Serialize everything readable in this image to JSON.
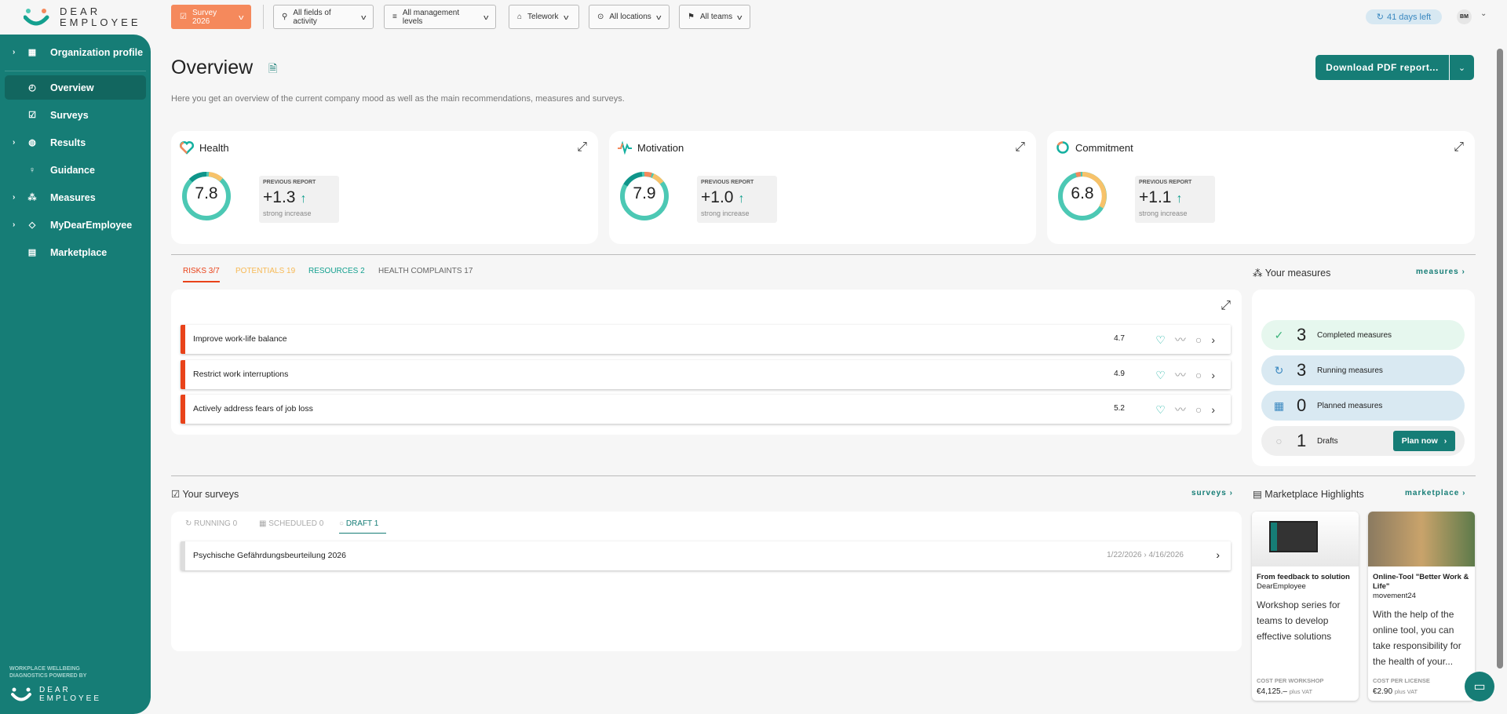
{
  "brand": {
    "line1": "DEAR",
    "line2": "EMPLOYEE",
    "powered": "WORKPLACE WELLBEING DIAGNOSTICS POWERED BY"
  },
  "filters": {
    "survey": "Survey 2026",
    "activity": "All fields of activity",
    "management": "All management levels",
    "telework": "Telework",
    "locations": "All locations",
    "teams": "All teams"
  },
  "header": {
    "days_left": "41 days left",
    "avatar": "BM"
  },
  "sidebar": {
    "items": [
      {
        "label": "Organization profile"
      },
      {
        "label": "Overview"
      },
      {
        "label": "Surveys"
      },
      {
        "label": "Results"
      },
      {
        "label": "Guidance"
      },
      {
        "label": "Measures"
      },
      {
        "label": "MyDearEmployee"
      },
      {
        "label": "Marketplace"
      }
    ]
  },
  "page": {
    "title": "Overview",
    "subtitle": "Here you get an overview of the current company mood as well as the main recommendations, measures and surveys.",
    "download": "Download PDF report..."
  },
  "kpis": [
    {
      "title": "Health",
      "score": "7.8",
      "prev_label": "PREVIOUS REPORT",
      "delta": "+1.3",
      "desc": "strong increase"
    },
    {
      "title": "Motivation",
      "score": "7.9",
      "prev_label": "PREVIOUS REPORT",
      "delta": "+1.0",
      "desc": "strong increase"
    },
    {
      "title": "Commitment",
      "score": "6.8",
      "prev_label": "PREVIOUS REPORT",
      "delta": "+1.1",
      "desc": "strong increase"
    }
  ],
  "tabs": [
    {
      "label": "RISKS 3/7",
      "color": "#e9431a"
    },
    {
      "label": "POTENTIALS 19",
      "color": "#f7b955"
    },
    {
      "label": "RESOURCES 2",
      "color": "#14a08f"
    },
    {
      "label": "HEALTH COMPLAINTS 17",
      "color": "#666666"
    }
  ],
  "risks": [
    {
      "title": "Improve work-life balance",
      "score": "4.7"
    },
    {
      "title": "Restrict work interruptions",
      "score": "4.9"
    },
    {
      "title": "Actively address fears of job loss",
      "score": "5.2"
    }
  ],
  "measures": {
    "title": "Your measures",
    "link": "measures",
    "completed": {
      "count": "3",
      "label": "Completed measures"
    },
    "running": {
      "count": "3",
      "label": "Running measures"
    },
    "planned": {
      "count": "0",
      "label": "Planned measures"
    },
    "drafts": {
      "count": "1",
      "label": "Drafts"
    },
    "plan_now": "Plan now"
  },
  "surveys": {
    "title": "Your surveys",
    "link": "surveys",
    "tabs": [
      {
        "label": "RUNNING",
        "count": "0"
      },
      {
        "label": "SCHEDULED",
        "count": "0"
      },
      {
        "label": "DRAFT",
        "count": "1"
      }
    ],
    "items": [
      {
        "title": "Psychische Gefährdungsbeurteilung 2026",
        "start": "1/22/2026",
        "end": "4/16/2026"
      }
    ]
  },
  "marketplace": {
    "title": "Marketplace Highlights",
    "link": "marketplace",
    "items": [
      {
        "title": "From feedback to solution",
        "provider": "DearEmployee",
        "desc": "Workshop series for teams to develop effective solutions",
        "cost_label": "COST PER WORKSHOP",
        "price": "€4,125.–",
        "vat": "plus VAT"
      },
      {
        "title": "Online-Tool \"Better Work & Life\"",
        "provider": "movement24",
        "desc": "With the help of the online tool, you can take responsibility for the health of your...",
        "cost_label": "COST PER LICENSE",
        "price": "€2.90",
        "vat": "plus VAT"
      }
    ]
  },
  "colors": {
    "teal": "#167d76",
    "orange": "#f5895c",
    "risk": "#e9431a"
  }
}
